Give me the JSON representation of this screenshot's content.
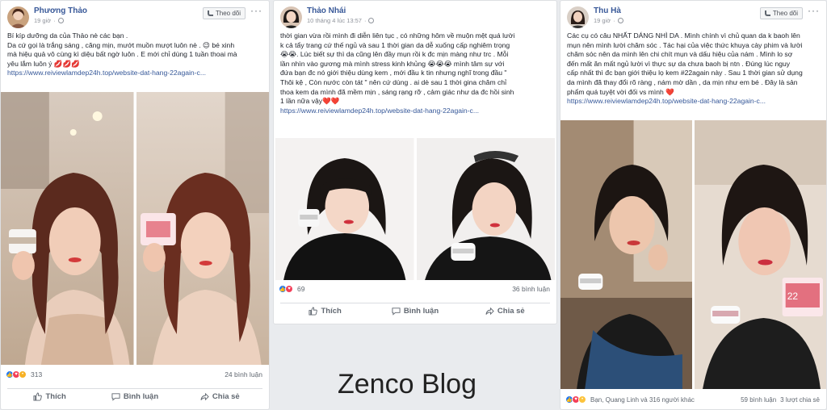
{
  "posts": [
    {
      "name": "Phương Thảo",
      "time": "19 giờ",
      "follow": "Theo dõi",
      "text": "Bí kíp dưỡng da của Thảo nè các bạn .\nDa cứ gọi là trắng sáng , căng mịn, mướt muồn mượt luôn nè . 😉 bé xinh\nmà hiệu quả vô cùng kì diệu bất ngờ luôn . E mới chỉ dùng 1 tuần thoai mà\nyêu lắm luôn ý 💋💋💋",
      "link": "https://www.reiviewlamdep24h.top/website-dat-hang-22again-c...",
      "reactions": "313",
      "comments": "24 bình luận",
      "share_count": "",
      "like": "Thích",
      "comment": "Bình luận",
      "share": "Chia sẻ"
    },
    {
      "name": "Thảo Nhái",
      "time": "10 tháng 4 lúc 13:57",
      "follow": "",
      "text": "thời gian vừa rồi mình đi diễn liên tục , có những hôm về muộn mệt quá lười\nk cả tẩy trang cứ thế ngủ và sau 1 thời gian da dễ xuống cấp nghiêm trọng\n😭😭. Lúc biết sự thì da cũng lên đầy mụn rồi k đc mịn màng như trc . Mỗi\nlần nhìn vào gương mà mình stress kinh khủng 😭😭😭 mình tâm sự với\nđứa bạn đc nó giới thiệu dùng kem , mới đầu k tin nhưng nghĩ trong đầu \"\nThôi kệ , Còn nước còn tát \" nên cứ dùng . ai dè sau 1 thời gina chăm chỉ\nthoa kem da mình đã mềm mịn , sáng rạng rỡ , cảm giác như da đc hồi sinh\n1 lần nữa vậy❤️❤️",
      "link": "https://www.reiviewlamdep24h.top/website-dat-hang-22again-c...",
      "reactions": "69",
      "comments": "36 bình luận",
      "share_count": "",
      "like": "Thích",
      "comment": "Bình luận",
      "share": "Chia sẻ"
    },
    {
      "name": "Thu Hà",
      "time": "19 giờ",
      "follow": "Theo dõi",
      "text": "Các cụ có câu NHẤT DÁNG NHÌ DA . Mình chính vì chủ quan da k baoh lên\nmụn nên mình lười chăm sóc . Tác hại của việc thức khuya cày phim và lười\nchăm sóc nên da mình lên chi chít mụn và dấu hiệu của nám . Mình lo sợ\nđến mất ăn mất ngủ lười vì thực sự da chưa baoh bị ntn . Đúng lúc nguy\ncấp nhất thì đc bạn giới thiệu lọ kem #22again này . Sau 1 thời gian sử dụng\nda mình đã thay đổi rõ ràng , nám mờ dần , da mịn như em bé . Đây là sản\nphẩm quá tuyệt vời đối vs mình ❤️",
      "link": "https://www.reiviewlamdep24h.top/website-dat-hang-22again-c...",
      "reactions": "Bạn, Quang Linh và 316 người khác",
      "comments": "59 bình luận",
      "share_count": "3 lượt chia sẻ",
      "like": "Thích",
      "comment": "Bình luận",
      "share": "Chia sẻ"
    }
  ],
  "watermark": "Zenco Blog",
  "colors": {
    "link": "#365899",
    "name": "#385898",
    "like": "#2078f4",
    "love": "#f33e58"
  }
}
